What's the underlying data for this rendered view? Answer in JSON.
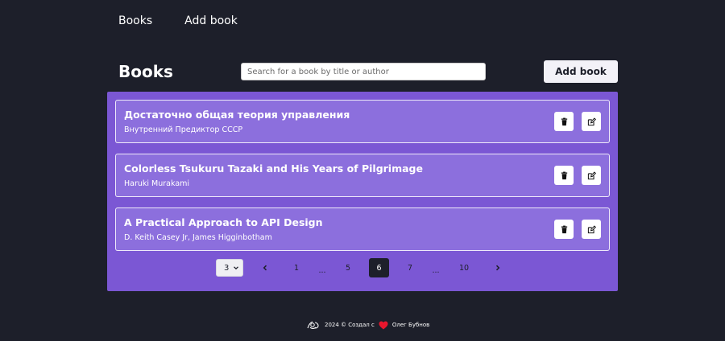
{
  "nav": {
    "books": "Books",
    "add_book": "Add book"
  },
  "header": {
    "title": "Books",
    "search_placeholder": "Search for a book by title or author",
    "add_button": "Add book"
  },
  "books": [
    {
      "title": "Достаточно общая теория управления",
      "author": "Внутренний Предиктор СССР"
    },
    {
      "title": "Colorless Tsukuru Tazaki and His Years of Pilgrimage",
      "author": "Haruki Murakami"
    },
    {
      "title": "A Practical Approach to API Design",
      "author": "D. Keith Casey Jr, James Higginbotham"
    }
  ],
  "pagination": {
    "per_page": "3",
    "pages": [
      "1",
      "...",
      "5",
      "6",
      "7",
      "...",
      "10"
    ],
    "current_page": "6"
  },
  "footer": {
    "year_text": "2024 © Создал с",
    "author": "Олег Бубнов"
  },
  "colors": {
    "background": "#1d1f2a",
    "panel": "#7b57d4",
    "card": "#8c6fdd",
    "heart": "#e8162d"
  },
  "icons": {
    "book_actions": [
      "trash-icon",
      "edit-icon"
    ],
    "pager": [
      "chevron-left-icon",
      "chevron-right-icon"
    ],
    "footer": [
      "logo-icon",
      "heart-icon"
    ]
  }
}
